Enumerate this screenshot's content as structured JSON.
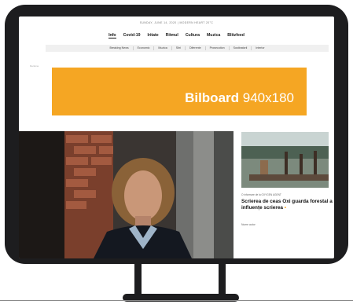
{
  "top_line": "SUNDAY, JUNE 14, 2020 | MODERN HEART 20°C",
  "main_nav": {
    "items": [
      "Info",
      "Covid-19",
      "Iritate",
      "Ritmul",
      "Cultura",
      "Muzica",
      "Blitzfeed"
    ],
    "active_index": 0
  },
  "sub_nav": {
    "items": [
      "Breaking News",
      "Economic",
      "Muzica",
      "Stiri",
      "Diferente",
      "Prosecution",
      "Sustinatorii",
      "Interior"
    ]
  },
  "ad_label": "Reclama",
  "billboard": {
    "label_bold": "Bilboard",
    "label_size": "940x180",
    "color": "#f5a623"
  },
  "hero": {
    "image": "portrait-woman-dark-jacket"
  },
  "side_story": {
    "image": "field-with-construction",
    "kicker": "O informare de la OXYGEN AGENT",
    "title": "Scrierea de ceas Oxi guarda forestal a influențe scrierea",
    "title_suffix": "•",
    "author": "Nume autor"
  }
}
